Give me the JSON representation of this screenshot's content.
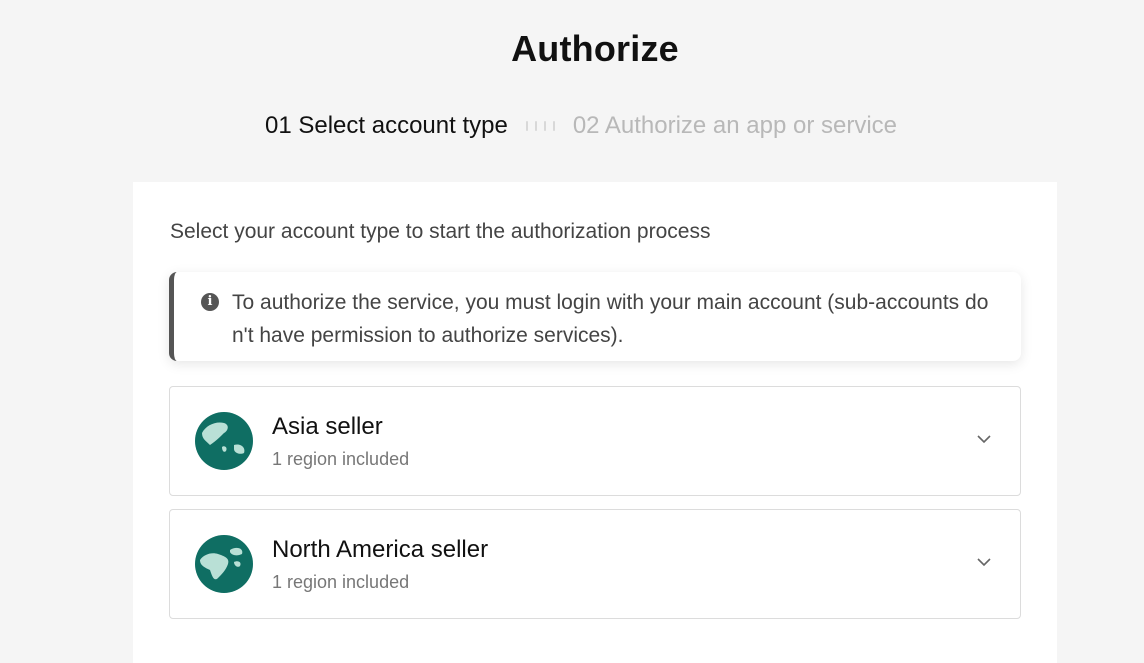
{
  "page": {
    "title": "Authorize"
  },
  "steps": [
    {
      "label": "01 Select account type",
      "active": true
    },
    {
      "label": "02 Authorize an app or service",
      "active": false
    }
  ],
  "card": {
    "intro": "Select your account type to start the authorization process",
    "notice": {
      "icon": "info-icon",
      "text": "To authorize the service, you must login with your main account (sub-accounts don't have permission to authorize services)."
    },
    "accounts": [
      {
        "name": "Asia seller",
        "sub": "1 region included",
        "icon": "asia-globe-icon"
      },
      {
        "name": "North America seller",
        "sub": "1 region included",
        "icon": "north-america-globe-icon"
      }
    ]
  },
  "colors": {
    "globe": "#0f6e63",
    "land": "#b9e0d6",
    "notice_bar": "#555555"
  }
}
